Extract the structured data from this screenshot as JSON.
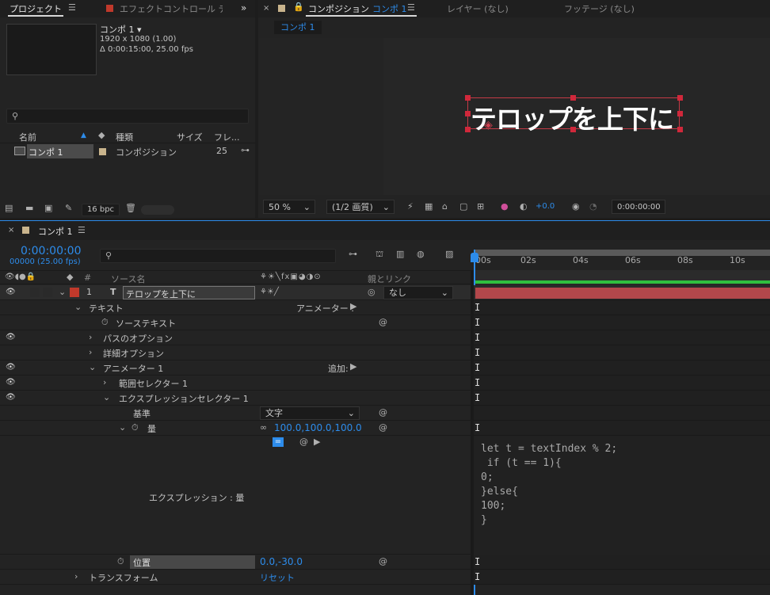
{
  "project": {
    "tab_project": "プロジェクト",
    "tab_effects": "エフェクトコントロール テ",
    "comp_name": "コンポ 1 ▾",
    "comp_res": "1920 x 1080 (1.00)",
    "comp_dur": "Δ 0:00:15:00, 25.00 fps",
    "search_placeholder": "",
    "col_name": "名前",
    "col_type": "種類",
    "col_size": "サイズ",
    "col_frame": "フレ...",
    "item_name": "コンポ 1",
    "item_type": "コンポジション",
    "item_fps": "25",
    "bpc": "16 bpc"
  },
  "viewer": {
    "tab_comp": "コンポジション",
    "tab_comp_name": "コンポ 1",
    "tab_layer": "レイヤー (なし)",
    "tab_footage": "フッテージ (なし)",
    "breadcrumb": "コンポ 1",
    "canvas_text": "テロップを上下に",
    "zoom": "50 %",
    "resolution": "(1/2 画質)",
    "exposure": "+0.0",
    "timecode": "0:00:00:00"
  },
  "timeline": {
    "tab": "コンポ 1",
    "timecode": "0:00:00:00",
    "fps": "00000 (25.00 fps)",
    "col_num": "#",
    "col_source": "ソース名",
    "col_parent": "親とリンク",
    "ruler": [
      "00s",
      "02s",
      "04s",
      "06s",
      "08s",
      "10s"
    ],
    "layer": {
      "num": "1",
      "type": "T",
      "name": "テロップを上下に",
      "parent": "なし"
    },
    "props": {
      "text": "テキスト",
      "animator_label": "アニメーター :",
      "source_text": "ソーステキスト",
      "path_options": "パスのオプション",
      "more_options": "詳細オプション",
      "animator1": "アニメーター 1",
      "add_label": "追加:",
      "range_selector": "範囲セレクター 1",
      "expr_selector": "エクスプレッションセレクター 1",
      "basis": "基準",
      "basis_value": "文字",
      "amount": "量",
      "amount_value": "100.0,100.0,100.0",
      "expression_label": "エクスプレッション : 量",
      "position": "位置",
      "position_value": "0.0,-30.0",
      "transform": "トランスフォーム",
      "reset": "リセット"
    },
    "expression_code": "let t = textIndex % 2;\n if (t == 1){\n0;\n}else{\n100;\n}"
  }
}
